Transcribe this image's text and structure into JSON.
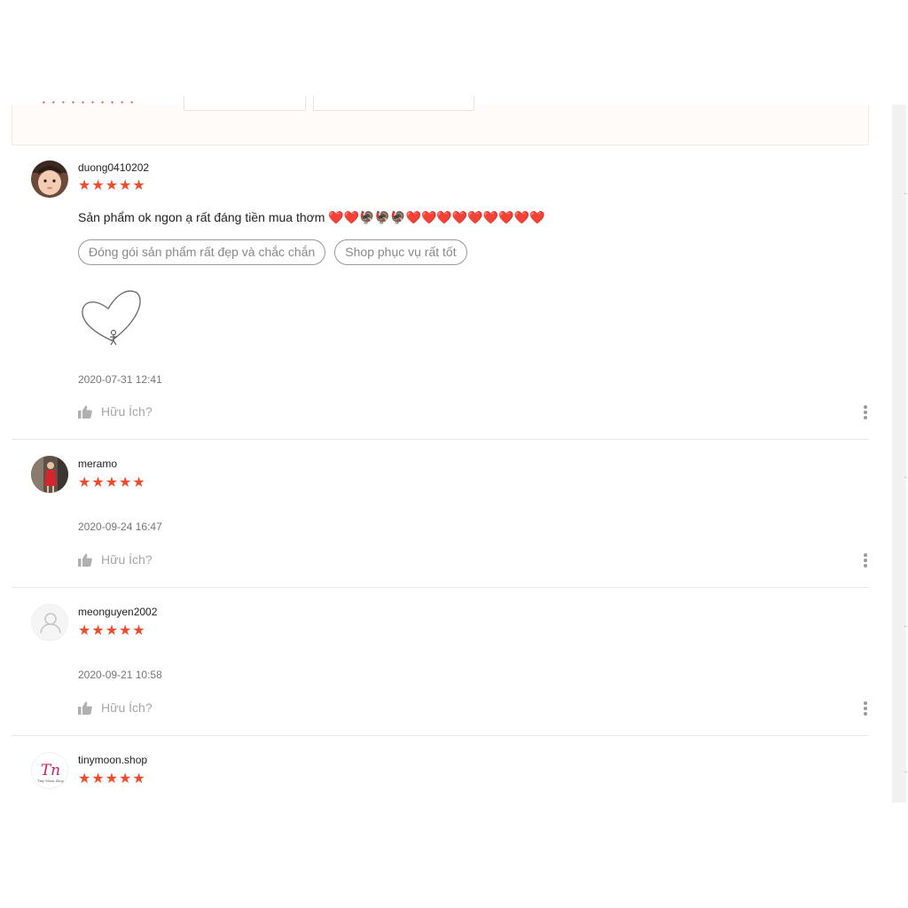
{
  "colors": {
    "accent": "#ee4d2d",
    "muted": "#a5a5a5",
    "border": "#e8e8e8"
  },
  "reviews": [
    {
      "username": "duong0410202",
      "rating": 5,
      "stars": "★★★★★",
      "comment": "Sản phẩm ok ngon ạ rất đáng tiền mua thơm",
      "comment_emoji": "❤️❤️🦃🦃🦃❤️❤️❤️❤️❤️❤️❤️❤️❤️",
      "tags": [
        "Đóng gói sản phẩm rất đẹp và chắc chắn",
        "Shop phục vụ rất tốt"
      ],
      "time": "2020-07-31 12:41",
      "helpful_label": "Hữu Ích?",
      "avatar_icon": "child-photo-avatar"
    },
    {
      "username": "meramo",
      "rating": 5,
      "stars": "★★★★★",
      "time": "2020-09-24 16:47",
      "helpful_label": "Hữu Ích?",
      "avatar_icon": "woman-photo-avatar"
    },
    {
      "username": "meonguyen2002",
      "rating": 5,
      "stars": "★★★★★",
      "time": "2020-09-21 10:58",
      "helpful_label": "Hữu Ích?",
      "avatar_icon": "default-user-avatar"
    },
    {
      "username": "tinymoon.shop",
      "rating": 5,
      "stars": "★★★★★",
      "avatar_icon": "tinymoon-logo-avatar",
      "avatar_logo_text": "Tn",
      "avatar_logo_subtext": "Tiny Moon Shop"
    }
  ]
}
